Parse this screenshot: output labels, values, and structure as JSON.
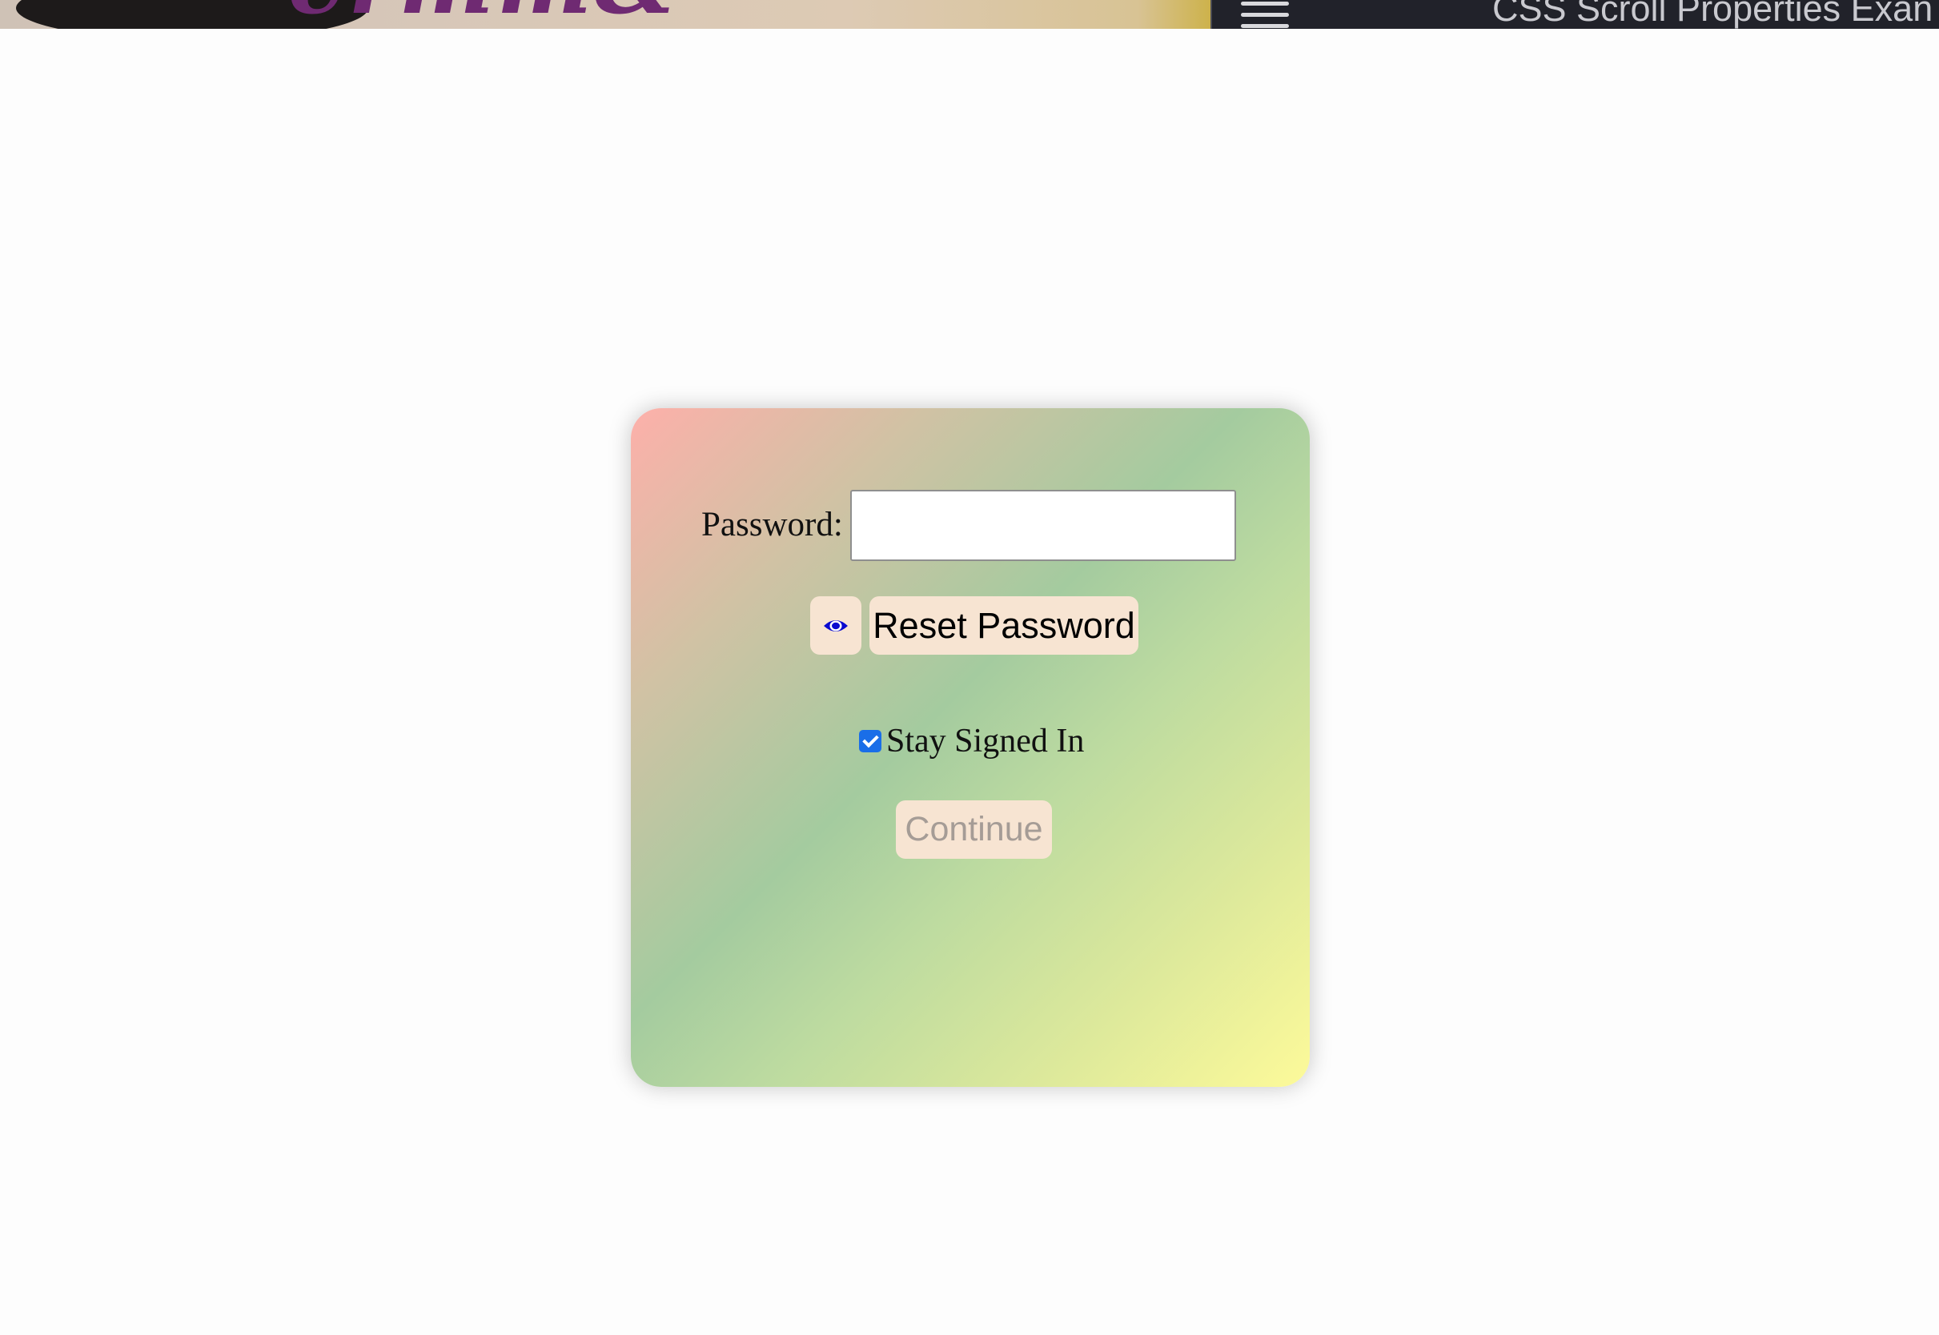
{
  "top_bar": {
    "video_text": "ermm&",
    "title": "CSS Scroll Properties Exan"
  },
  "form": {
    "password_label": "Password:",
    "password_value": "",
    "toggle_visibility_icon": "eye-icon",
    "reset_button_label": "Reset Password",
    "stay_signed_in_label": "Stay Signed In",
    "stay_signed_in_checked": true,
    "continue_button_label": "Continue",
    "continue_disabled": true
  },
  "colors": {
    "eye_icon": "#0a0ad0",
    "checkbox": "#1a6ee8",
    "button_bg": "#f7e4d2",
    "disabled_text": "#a59c96",
    "gradient": [
      "#fdb0aa",
      "#a4cb9f",
      "#fdfa9a"
    ]
  }
}
